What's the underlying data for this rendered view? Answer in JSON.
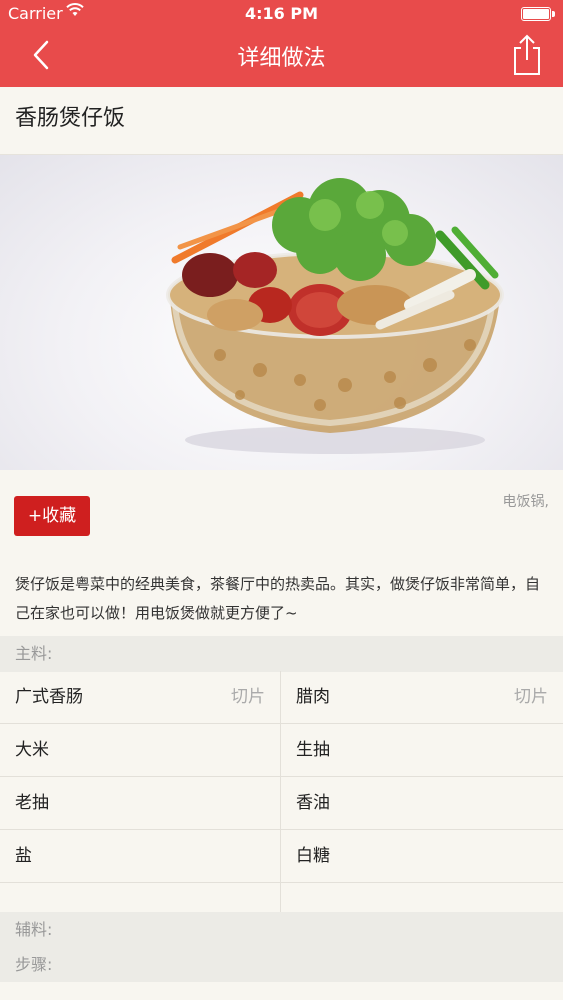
{
  "status": {
    "carrier": "Carrier",
    "time": "4:16 PM"
  },
  "nav": {
    "title": "详细做法",
    "back_icon": "chevron-left-icon",
    "share_icon": "share-icon"
  },
  "recipe": {
    "title": "香肠煲仔饭",
    "favorite_label": "+收藏",
    "tools": "电饭锅,",
    "description": "煲仔饭是粤菜中的经典美食，茶餐厅中的热卖品。其实，做煲仔饭非常简单，自己在家也可以做！用电饭煲做就更方便了~"
  },
  "main_ingredients": {
    "header": "主料:",
    "rows": [
      [
        {
          "name": "广式香肠",
          "amount": "切片"
        },
        {
          "name": "腊肉",
          "amount": "切片"
        }
      ],
      [
        {
          "name": "大米",
          "amount": ""
        },
        {
          "name": "生抽",
          "amount": ""
        }
      ],
      [
        {
          "name": "老抽",
          "amount": ""
        },
        {
          "name": "香油",
          "amount": ""
        }
      ],
      [
        {
          "name": "盐",
          "amount": ""
        },
        {
          "name": "白糖",
          "amount": ""
        }
      ]
    ]
  },
  "secondary": {
    "header": "辅料:"
  },
  "steps": {
    "header": "步骤:"
  },
  "colors": {
    "accent": "#e84b4b",
    "button": "#cf1f1f"
  }
}
